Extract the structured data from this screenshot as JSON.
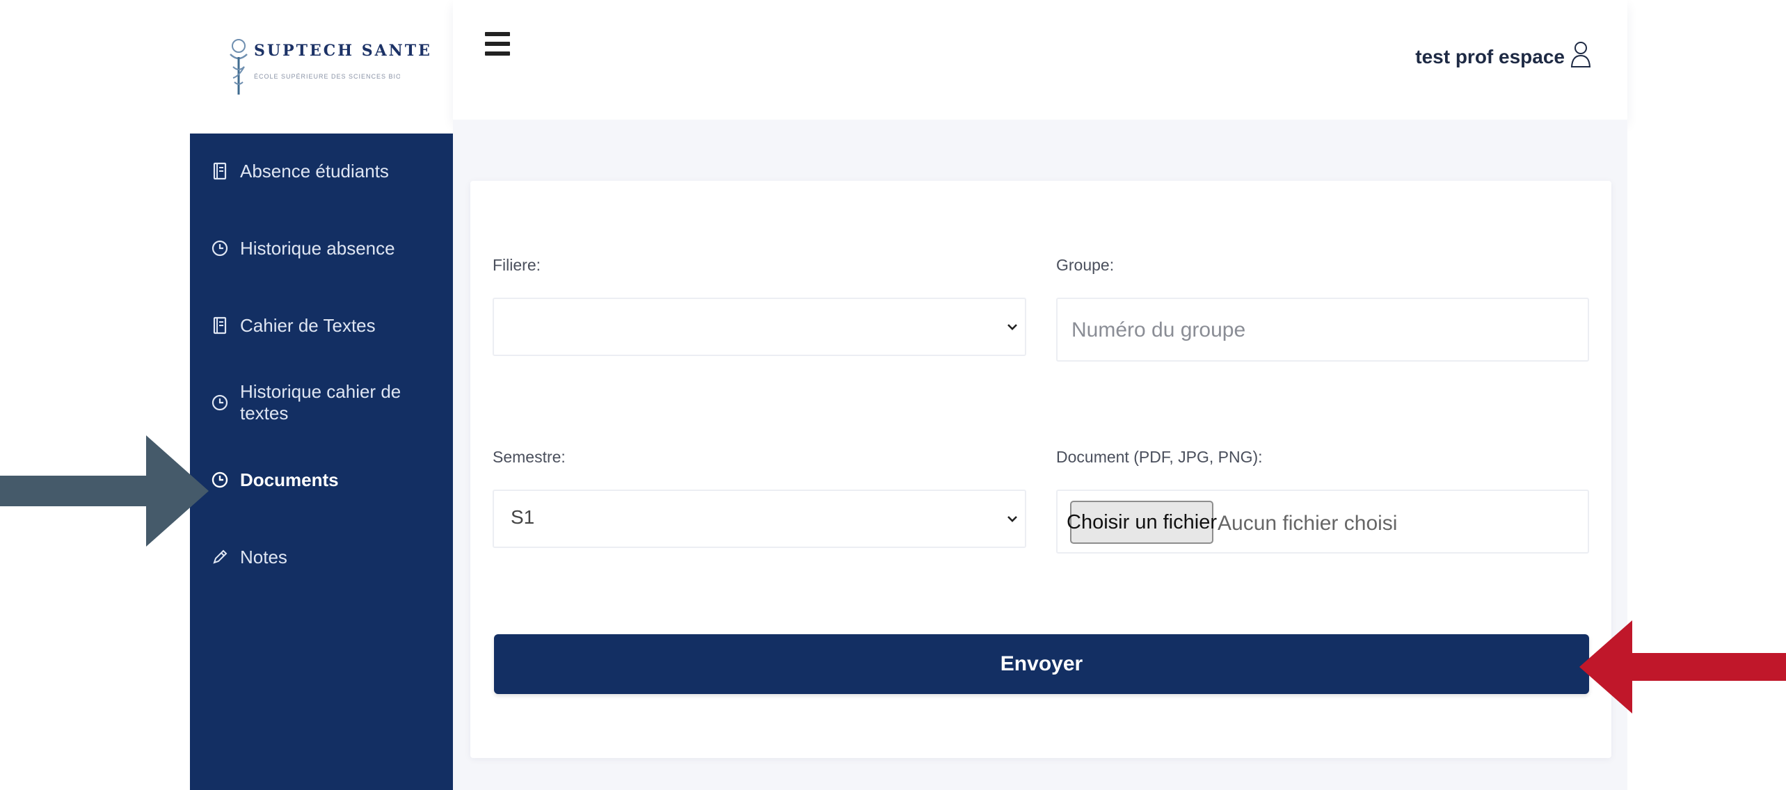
{
  "brand": {
    "title": "SUPTECH SANTE",
    "subtitle": "École Supérieure des Sciences Biomédicales et des Technologies de Santé"
  },
  "sidebar": {
    "items": [
      {
        "label": "Absence étudiants",
        "icon": "book-icon"
      },
      {
        "label": "Historique absence",
        "icon": "clock-icon"
      },
      {
        "label": "Cahier de Textes",
        "icon": "book-icon"
      },
      {
        "label": "Historique cahier de textes",
        "icon": "clock-icon"
      },
      {
        "label": "Documents",
        "icon": "clock-icon",
        "active": true
      },
      {
        "label": "Notes",
        "icon": "pencil-icon"
      }
    ]
  },
  "header": {
    "user_name": "test prof espace",
    "menu_icon": "hamburger-icon",
    "user_icon": "user-icon"
  },
  "form": {
    "filiere": {
      "label": "Filiere:",
      "value": ""
    },
    "groupe": {
      "label": "Groupe:",
      "placeholder": "Numéro du groupe"
    },
    "semestre": {
      "label": "Semestre:",
      "value": "S1"
    },
    "document": {
      "label": "Document (PDF, JPG, PNG):",
      "button_label": "Choisir un fichier",
      "status": "Aucun fichier choisi"
    },
    "submit_label": "Envoyer"
  },
  "colors": {
    "sidebar": "#132f63",
    "button": "#132f63",
    "arrow_left": "#455a6a",
    "arrow_right": "#c0172a"
  }
}
